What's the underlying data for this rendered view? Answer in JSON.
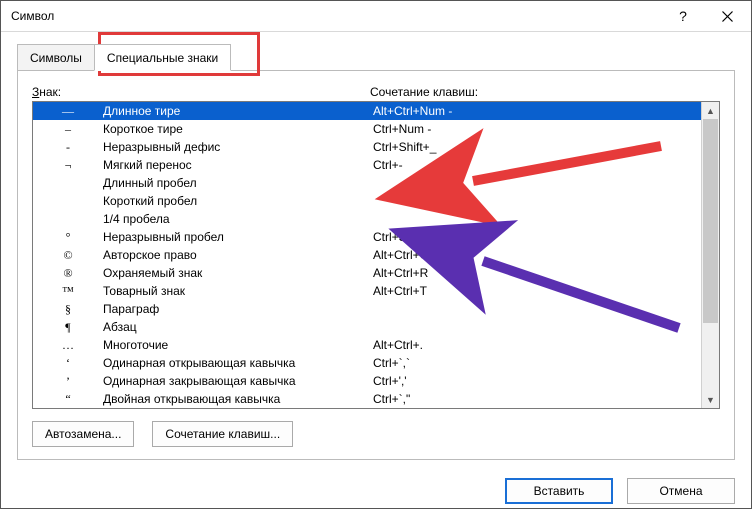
{
  "window": {
    "title": "Символ"
  },
  "tabs": {
    "symbols": "Символы",
    "special": "Специальные знаки"
  },
  "headers": {
    "symbol_pre": "З",
    "symbol_post": "нак:",
    "shortcut": "Сочетание клавиш:"
  },
  "rows": [
    {
      "sym": "—",
      "name": "Длинное тире",
      "key": "Alt+Ctrl+Num -",
      "selected": true
    },
    {
      "sym": "–",
      "name": "Короткое тире",
      "key": "Ctrl+Num -"
    },
    {
      "sym": "-",
      "name": "Неразрывный дефис",
      "key": "Ctrl+Shift+_"
    },
    {
      "sym": "¬",
      "name": "Мягкий перенос",
      "key": "Ctrl+-"
    },
    {
      "sym": "",
      "name": "Длинный пробел",
      "key": ""
    },
    {
      "sym": "",
      "name": "Короткий пробел",
      "key": ""
    },
    {
      "sym": "",
      "name": "1/4 пробела",
      "key": ""
    },
    {
      "sym": "°",
      "name": "Неразрывный пробел",
      "key": "Ctrl+Shift+Пробел"
    },
    {
      "sym": "©",
      "name": "Авторское право",
      "key": "Alt+Ctrl+C"
    },
    {
      "sym": "®",
      "name": "Охраняемый знак",
      "key": "Alt+Ctrl+R"
    },
    {
      "sym": "™",
      "name": "Товарный знак",
      "key": "Alt+Ctrl+T"
    },
    {
      "sym": "§",
      "name": "Параграф",
      "key": ""
    },
    {
      "sym": "¶",
      "name": "Абзац",
      "key": ""
    },
    {
      "sym": "…",
      "name": "Многоточие",
      "key": "Alt+Ctrl+."
    },
    {
      "sym": "‘",
      "name": "Одинарная открывающая кавычка",
      "key": "Ctrl+`,`"
    },
    {
      "sym": "’",
      "name": "Одинарная закрывающая кавычка",
      "key": "Ctrl+','"
    },
    {
      "sym": "“",
      "name": "Двойная открывающая кавычка",
      "key": "Ctrl+`,\""
    }
  ],
  "buttons": {
    "autocorrect": "Автозамена...",
    "shortcut": "Сочетание клавиш...",
    "insert": "Вставить",
    "cancel": "Отмена"
  }
}
